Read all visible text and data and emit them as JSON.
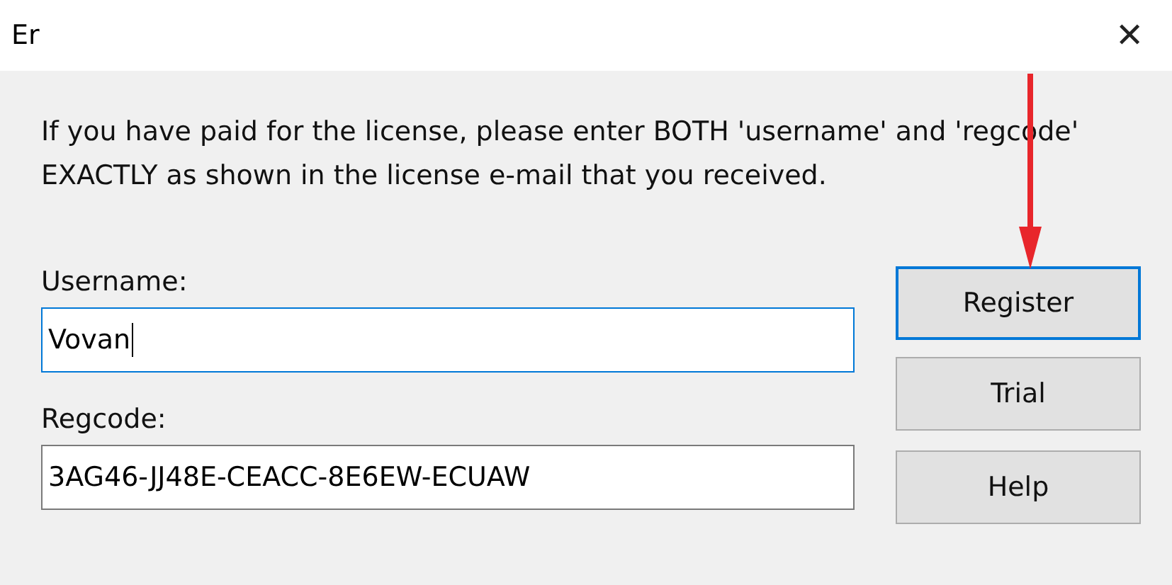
{
  "window": {
    "title": "Er",
    "close": "✕"
  },
  "message": "If you have paid for the license, please enter BOTH 'username' and 'regcode' EXACTLY as shown in the license e-mail that you received.",
  "fields": [
    {
      "label": "Username:",
      "value": "Vovan",
      "focused": true
    },
    {
      "label": "Regcode:",
      "value": "3AG46-JJ48E-CEACC-8E6EW-ECUAW",
      "focused": false
    }
  ],
  "buttons": [
    {
      "label": "Register",
      "focused": true
    },
    {
      "label": "Trial",
      "focused": false
    },
    {
      "label": "Help",
      "focused": false
    }
  ]
}
